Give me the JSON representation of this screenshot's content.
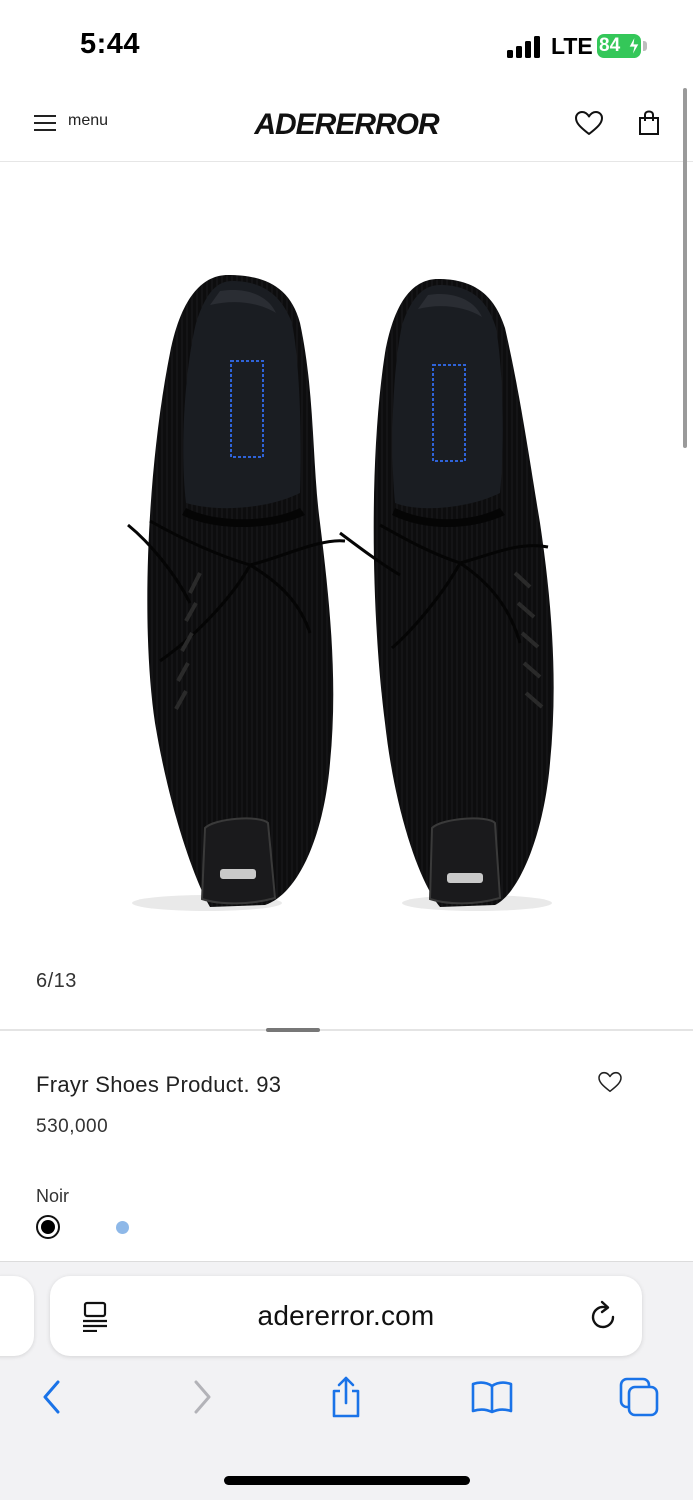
{
  "status_bar": {
    "time": "5:44",
    "network": "LTE",
    "battery_level": "84",
    "battery_color": "#34c759",
    "icons": [
      "signal-bars-icon",
      "charging-bolt-icon"
    ]
  },
  "header": {
    "menu_label": "menu",
    "logo": "ADERERROR",
    "icons": [
      "hamburger-icon",
      "heart-icon",
      "shopping-bag-icon"
    ]
  },
  "gallery": {
    "counter": "6/13",
    "current_index": 6,
    "total": 13
  },
  "product": {
    "name": "Frayr Shoes Product. 93",
    "price": "530,000",
    "color_name": "Noir",
    "swatches": [
      {
        "color": "#000000",
        "selected": true
      },
      {
        "color": "#8eb8e8",
        "selected": false
      }
    ]
  },
  "browser": {
    "url": "adererror.com",
    "icons": [
      "reader-icon",
      "reload-icon",
      "back-icon",
      "forward-icon",
      "share-icon",
      "bookmarks-icon",
      "tabs-icon"
    ]
  }
}
